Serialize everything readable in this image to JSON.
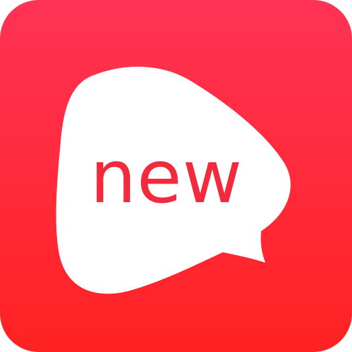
{
  "app_icon": {
    "logo_text": "new",
    "colors": {
      "background_top": "#ff3355",
      "background_bottom": "#ff2222",
      "bubble": "#ffffff",
      "logo_text": "#f32a3d"
    },
    "icon": "chat-bubble-icon"
  }
}
